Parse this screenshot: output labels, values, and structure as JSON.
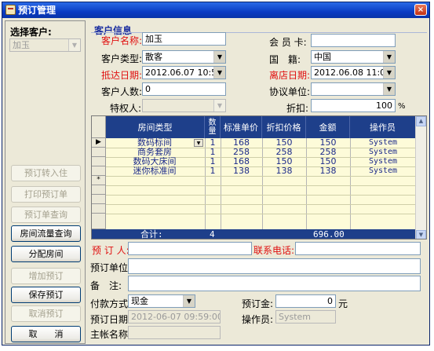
{
  "window": {
    "title": "预订管理",
    "close": "×"
  },
  "left": {
    "select_label": "选择客户:",
    "customer_value": "加玉",
    "buttons": [
      "预订转入住",
      "打印预订单",
      "预订单查询",
      "房间流量查询",
      "分配房间",
      "增加预订",
      "保存预订",
      "取消预订",
      "取　　消"
    ]
  },
  "customer": {
    "group_title": "客户信息",
    "name_label": "客户名称:",
    "name_value": "加玉",
    "type_label": "客户类型:",
    "type_value": "散客",
    "arrive_label": "抵达日期:",
    "arrive_value": "2012.06.07 10:51:00",
    "count_label": "客户人数:",
    "count_value": "0",
    "privilege_label": "特权人:",
    "card_label": "会 员 卡:",
    "card_value": "",
    "nation_label": "国　籍:",
    "nation_value": "中国",
    "depart_label": "离店日期:",
    "depart_value": "2012.06.08 11:00:00",
    "agreement_label": "协议单位:",
    "discount_label": "折扣:",
    "discount_value": "100",
    "discount_unit": "%"
  },
  "grid": {
    "headers": [
      "房间类型",
      "数量",
      "标准单价",
      "折扣价格",
      "金额",
      "操作员"
    ],
    "rows": [
      {
        "type": "数码标间",
        "qty": "1",
        "price": "168",
        "disc": "150",
        "amount": "150",
        "op": "System"
      },
      {
        "type": "商务套房",
        "qty": "1",
        "price": "258",
        "disc": "258",
        "amount": "258",
        "op": "System"
      },
      {
        "type": "数码大床间",
        "qty": "1",
        "price": "168",
        "disc": "150",
        "amount": "150",
        "op": "System"
      },
      {
        "type": "迷你标准间",
        "qty": "1",
        "price": "138",
        "disc": "138",
        "amount": "138",
        "op": "System"
      }
    ],
    "total_label": "合计:",
    "total_qty": "4",
    "total_amount": "696.00",
    "new_row_marker": "*"
  },
  "booking": {
    "booker_label": "预 订 人:",
    "booker_value": "",
    "phone_label": "联系电话:",
    "phone_value": "",
    "unit_label": "预订单位:",
    "unit_value": "",
    "note_label": "备　注:",
    "note_value": "",
    "pay_label": "付款方式:",
    "pay_value": "现金",
    "deposit_label": "预订金:",
    "deposit_value": "0",
    "deposit_unit": "元",
    "date_label": "预订日期:",
    "date_value": "2012-06-07 09:59:00",
    "operator_label": "操作员:",
    "operator_value": "System",
    "account_label": "主帐名称:"
  }
}
